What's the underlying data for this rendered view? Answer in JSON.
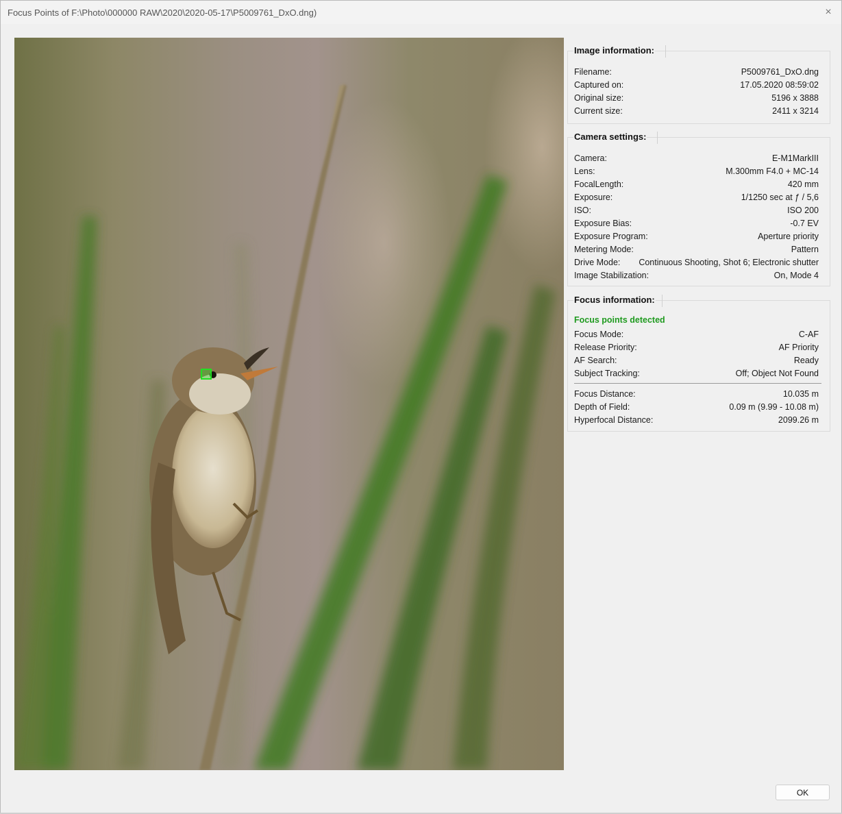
{
  "window": {
    "title": "Focus Points of F:\\Photo\\000000 RAW\\2020\\2020-05-17\\P5009761_DxO.dng)",
    "close_icon": "×",
    "ok_label": "OK"
  },
  "image_info": {
    "title": "Image information:",
    "rows": [
      {
        "label": "Filename:",
        "value": "P5009761_DxO.dng"
      },
      {
        "label": "Captured on:",
        "value": "17.05.2020 08:59:02"
      },
      {
        "label": "Original size:",
        "value": "5196 x 3888"
      },
      {
        "label": "Current size:",
        "value": "2411 x 3214"
      }
    ]
  },
  "camera_settings": {
    "title": "Camera settings:",
    "rows": [
      {
        "label": "Camera:",
        "value": "E-M1MarkIII"
      },
      {
        "label": "Lens:",
        "value": "M.300mm F4.0 + MC-14"
      },
      {
        "label": "FocalLength:",
        "value": "420 mm"
      },
      {
        "label": "Exposure:",
        "value": "1/1250 sec at ƒ / 5,6"
      },
      {
        "label": "ISO:",
        "value": "ISO 200"
      },
      {
        "label": "Exposure Bias:",
        "value": "-0.7 EV"
      },
      {
        "label": "Exposure Program:",
        "value": "Aperture priority"
      },
      {
        "label": "Metering Mode:",
        "value": "Pattern"
      },
      {
        "label": "Drive Mode:",
        "value": "Continuous Shooting, Shot 6; Electronic shutter"
      },
      {
        "label": "Image Stabilization:",
        "value": "On, Mode 4"
      }
    ]
  },
  "focus_info": {
    "title": "Focus information:",
    "status": "Focus points detected",
    "status_color": "#1f9a1f",
    "rows": [
      {
        "label": "Focus Mode:",
        "value": "C-AF"
      },
      {
        "label": "Release Priority:",
        "value": "AF Priority"
      },
      {
        "label": "AF Search:",
        "value": "Ready"
      },
      {
        "label": "Subject Tracking:",
        "value": "Off; Object Not Found"
      }
    ],
    "distance_rows": [
      {
        "label": "Focus Distance:",
        "value": "10.035 m"
      },
      {
        "label": "Depth of Field:",
        "value": "0.09 m (9.99 - 10.08 m)"
      },
      {
        "label": "Hyperfocal Distance:",
        "value": "2099.26 m"
      }
    ]
  },
  "focus_marker_color": "#22e022"
}
